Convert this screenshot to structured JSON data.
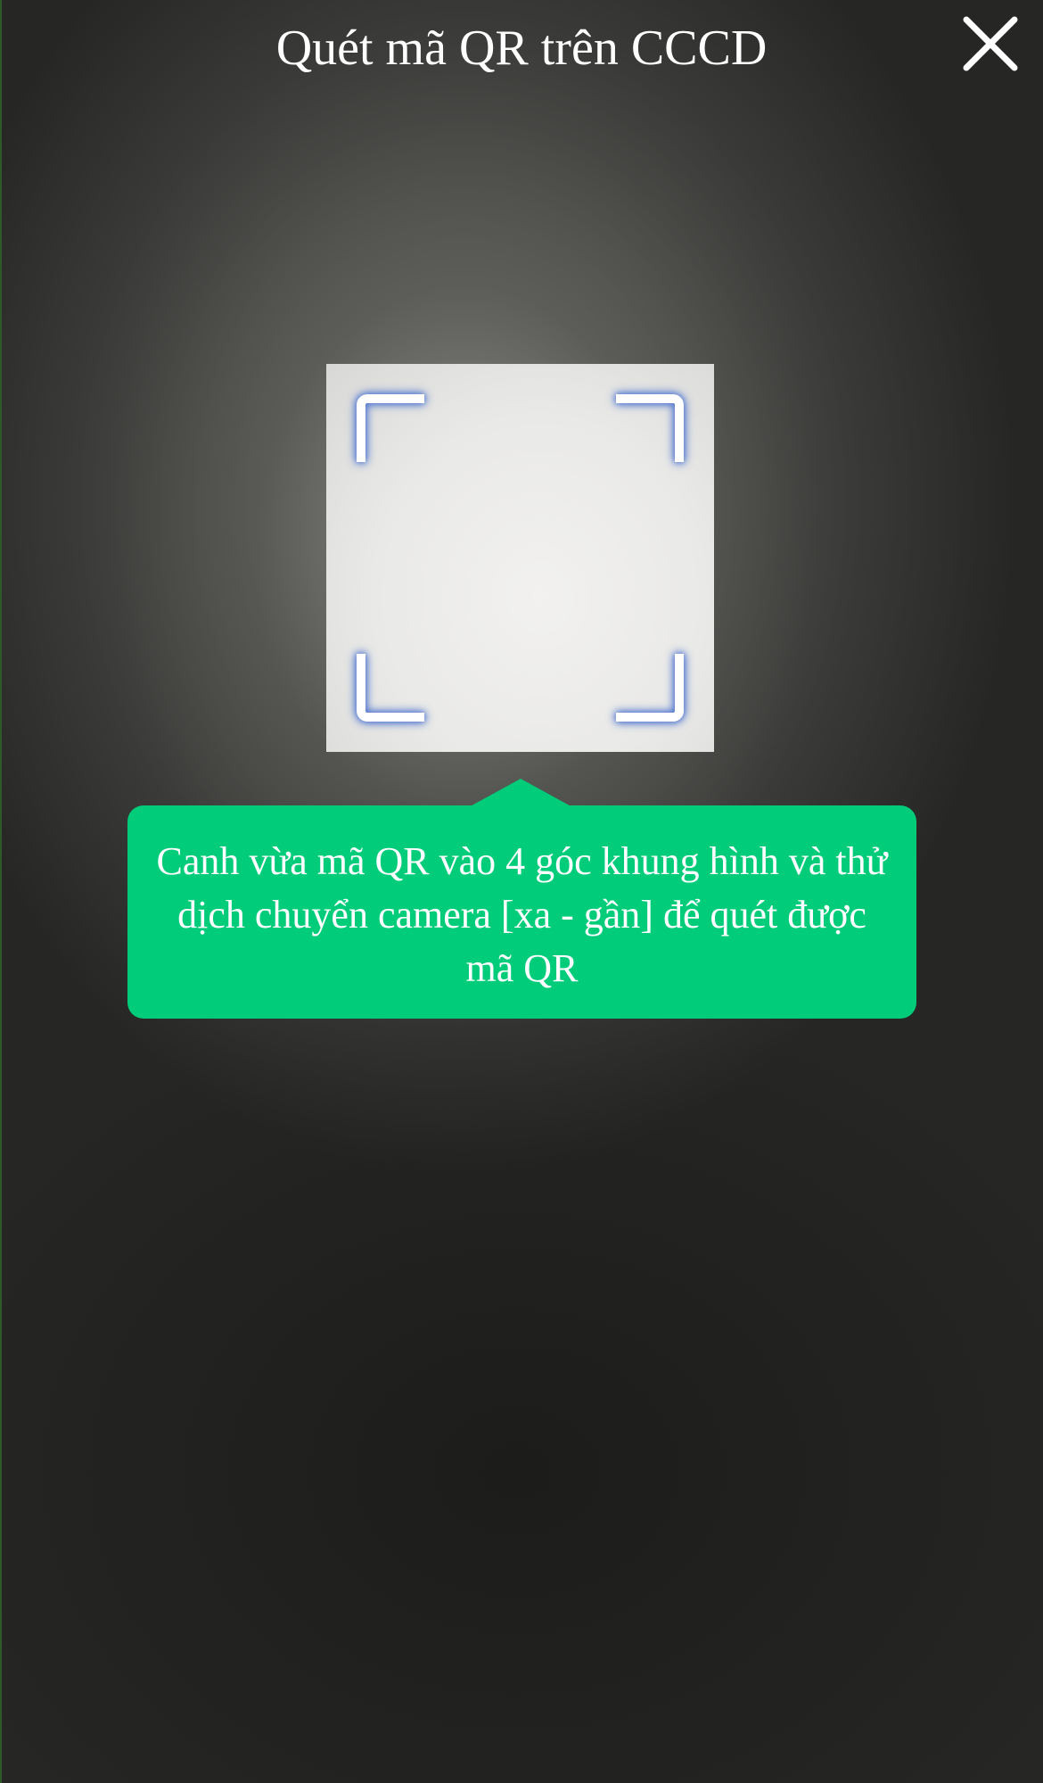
{
  "header": {
    "title": "Quét mã QR trên CCCD",
    "close_icon": "close-icon"
  },
  "scanner": {
    "corner_icon": "scan-corner-icon",
    "hint_text": "Canh vừa mã QR vào 4 góc khung hình và thử dịch chuyển camera [xa - gần] để quét được mã QR"
  },
  "colors": {
    "hint_background": "#00cc7a",
    "corner_glow": "#4f74c8",
    "title_text": "#ffffff"
  }
}
